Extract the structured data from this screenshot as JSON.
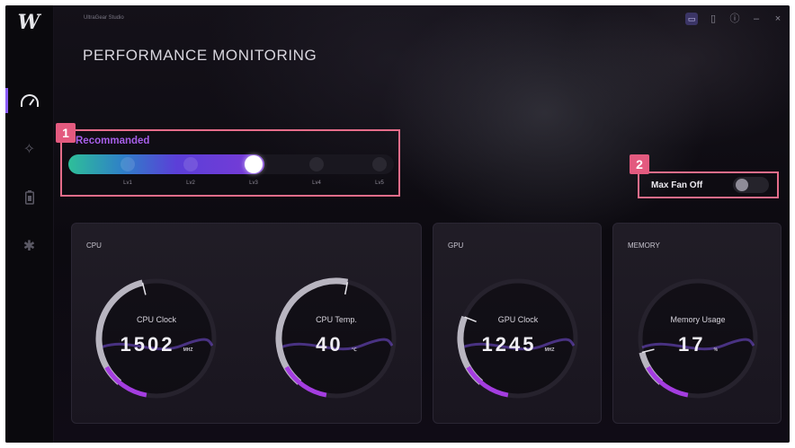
{
  "app": {
    "name": "UltraGear Studio"
  },
  "page_title": "PERFORMANCE MONITORING",
  "sidebar": {
    "items": [
      {
        "name": "performance",
        "icon": "gauge-icon",
        "active": true
      },
      {
        "name": "effects",
        "icon": "magic-wand-icon",
        "active": false
      },
      {
        "name": "battery",
        "icon": "battery-icon",
        "active": false
      },
      {
        "name": "settings",
        "icon": "gear-icon",
        "active": false
      }
    ]
  },
  "window_controls": {
    "minimize": "–",
    "close": "×",
    "info": "ⓘ"
  },
  "callouts": {
    "one": "1",
    "two": "2"
  },
  "performance_mode": {
    "label": "Recommanded",
    "levels": [
      "Lv1",
      "Lv2",
      "Lv3",
      "Lv4",
      "Lv5"
    ],
    "selected_level": "Lv3"
  },
  "fan": {
    "label": "Max Fan Off",
    "enabled": false
  },
  "panels": {
    "cpu": {
      "title": "CPU",
      "clock": {
        "label": "CPU Clock",
        "value": "1502",
        "unit": "MHZ",
        "level": 0.35
      },
      "temp": {
        "label": "CPU Temp.",
        "value": "40",
        "unit": "℃",
        "level": 0.42
      }
    },
    "gpu": {
      "title": "GPU",
      "clock": {
        "label": "GPU Clock",
        "value": "1245",
        "unit": "MHZ",
        "level": 0.2
      }
    },
    "memory": {
      "title": "MEMORY",
      "usage": {
        "label": "Memory Usage",
        "value": "17",
        "unit": "%",
        "level": 0.1
      }
    }
  },
  "colors": {
    "accent": "#8b5cf6",
    "callout": "#e35a7f",
    "gauge_start": "#2ebf99",
    "gauge_end": "#a43de0"
  }
}
